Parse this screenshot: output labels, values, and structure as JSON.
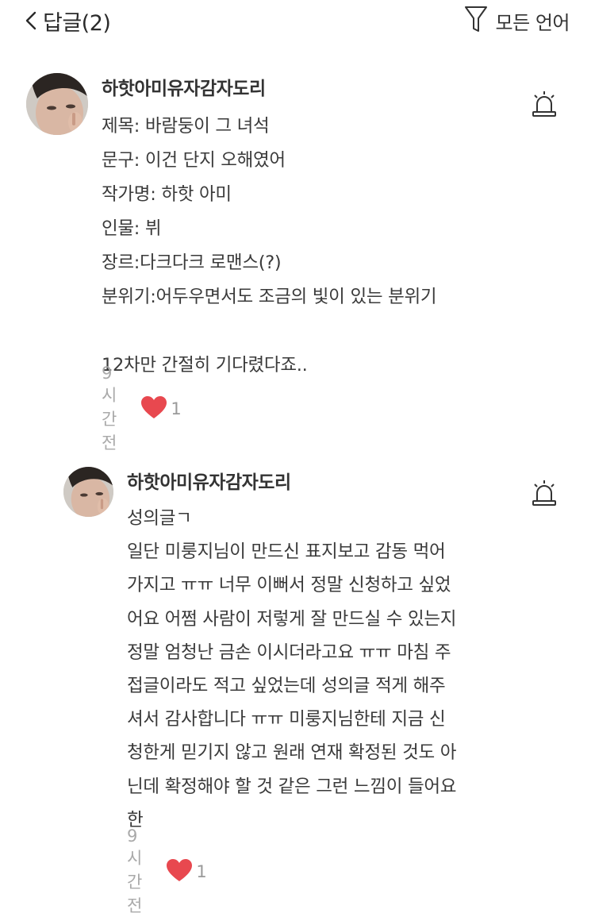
{
  "header": {
    "title": "답글(2)",
    "filter_label": "모든 언어"
  },
  "comments": [
    {
      "author": "하핫아미유자감자도리",
      "lines": [
        "제목: 바람둥이 그 녀석",
        "문구: 이건 단지 오해였어",
        "작가명: 하핫 아미",
        "인물: 뷔",
        "장르:다크다크 로맨스(?)",
        "분위기:어두우면서도 조금의 빛이 있는 분위기",
        "",
        "12차만 간절히 기다렸다죠.."
      ],
      "time": "9시간 전",
      "likes": "1"
    },
    {
      "author": "하핫아미유자감자도리",
      "lines": [
        "성의글ㄱ",
        "일단 미룽지님이 만드신 표지보고 감동 먹어",
        "가지고 ㅠㅠ 너무 이뻐서 정말 신청하고 싶었",
        "어요 어쩜 사람이 저렇게 잘 만드실 수 있는지",
        "정말 엄청난 금손 이시더라고요 ㅠㅠ 마침 주",
        "접글이라도 적고 싶었는데 성의글 적게 해주",
        "셔서 감사합니다 ㅠㅠ 미룽지님한테 지금 신",
        "청한게 믿기지 않고 원래 연재 확정된 것도 아",
        "닌데 확정해야 할 것 같은 그런 느낌이 들어요",
        "한"
      ],
      "time": "9시간 전",
      "likes": "1"
    }
  ],
  "colors": {
    "heart": "#e8484f",
    "text": "#333333",
    "meta": "#a9a9a9"
  },
  "icons": {
    "back": "chevron-left-icon",
    "filter": "funnel-icon",
    "report": "siren-icon",
    "like": "heart-icon"
  }
}
